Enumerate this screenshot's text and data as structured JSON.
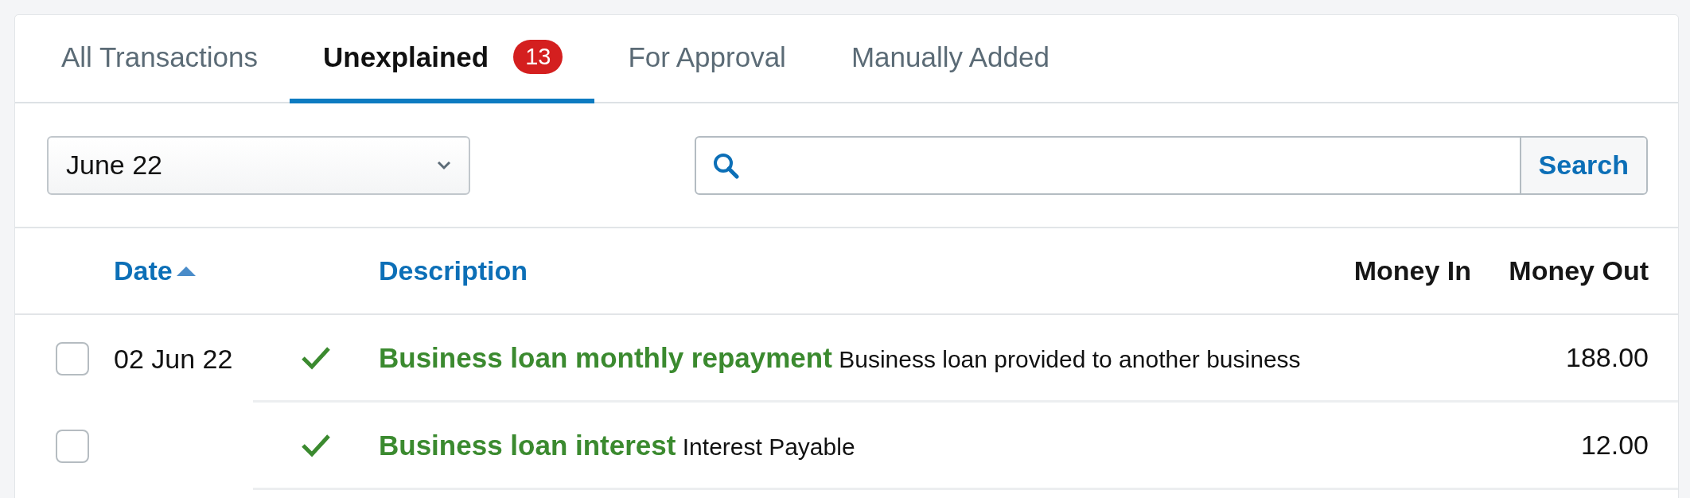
{
  "tabs": [
    {
      "label": "All Transactions",
      "selected": false
    },
    {
      "label": "Unexplained",
      "selected": true,
      "badge": "13"
    },
    {
      "label": "For Approval",
      "selected": false
    },
    {
      "label": "Manually Added",
      "selected": false
    }
  ],
  "filter": {
    "period": "June 22"
  },
  "search": {
    "button": "Search"
  },
  "table": {
    "columns": [
      {
        "label": "Date",
        "sortable": true,
        "sorted": true
      },
      {
        "label": "Description",
        "sortable": true
      },
      {
        "label": "Money In",
        "sortable": false
      },
      {
        "label": "Money Out",
        "sortable": false
      }
    ],
    "rows": [
      {
        "checked": false,
        "date": "02 Jun 22",
        "matched": true,
        "title": "Business loan monthly repayment",
        "category": "Business loan provided to another business",
        "money_out": "188.00"
      },
      {
        "checked": false,
        "matched": true,
        "title": "Business loan interest",
        "category": "Interest Payable",
        "money_out": "12.00"
      }
    ]
  }
}
